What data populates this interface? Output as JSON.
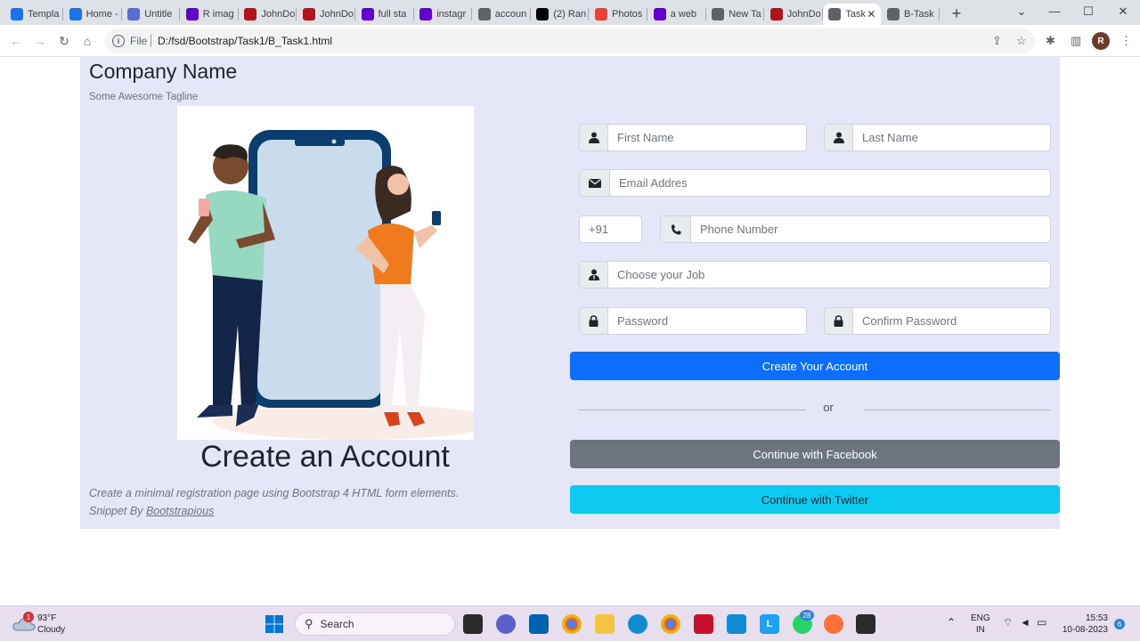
{
  "browser": {
    "tabs": [
      {
        "title": "Templa",
        "icon": "c-icon",
        "color": "#1a73e8"
      },
      {
        "title": "Home -",
        "icon": "c-icon",
        "color": "#1a73e8"
      },
      {
        "title": "Untitle",
        "icon": "doc-icon",
        "color": "#5b6bd6"
      },
      {
        "title": "R imag",
        "icon": "yahoo-icon",
        "color": "#6001d2"
      },
      {
        "title": "JohnDo",
        "icon": "r-icon",
        "color": "#b3131b"
      },
      {
        "title": "JohnDo",
        "icon": "r-icon",
        "color": "#b3131b"
      },
      {
        "title": "full sta",
        "icon": "yahoo-icon",
        "color": "#6001d2"
      },
      {
        "title": "instagr",
        "icon": "yahoo-icon",
        "color": "#6001d2"
      },
      {
        "title": "accoun",
        "icon": "globe-icon",
        "color": "#5f6368"
      },
      {
        "title": "(2) Ran",
        "icon": "x-icon",
        "color": "#000000"
      },
      {
        "title": "Photos",
        "icon": "photos-icon",
        "color": "#ea4335"
      },
      {
        "title": "a web",
        "icon": "yahoo-icon",
        "color": "#6001d2"
      },
      {
        "title": "New Ta",
        "icon": "globe-icon",
        "color": "#5f6368"
      },
      {
        "title": "JohnDo",
        "icon": "r-icon",
        "color": "#b3131b"
      },
      {
        "title": "Task",
        "icon": "globe-icon",
        "color": "#5f6368"
      },
      {
        "title": "B-Task",
        "icon": "globe-icon",
        "color": "#5f6368"
      }
    ],
    "active_tab_index": 14,
    "protocol": "File",
    "url": "D:/fsd/Bootstrap/Task1/B_Task1.html",
    "profile_initial": "R"
  },
  "page": {
    "company_name": "Company Name",
    "tagline": "Some Awesome Tagline",
    "heading": "Create an Account",
    "description": "Create a minimal registration page using Bootstrap 4 HTML form elements.",
    "snippet_prefix": "Snippet By ",
    "snippet_link": "Bootstrapious",
    "form": {
      "first_name_placeholder": "First Name",
      "last_name_placeholder": "Last Name",
      "email_placeholder": "Email Addres",
      "country_code": "+91",
      "phone_placeholder": "Phone Number",
      "job_placeholder": "Choose your Job",
      "password_placeholder": "Password",
      "confirm_password_placeholder": "Confirm Password",
      "create_button": "Create Your Account",
      "or_text": "or",
      "facebook_button": "Continue with Facebook",
      "twitter_button": "Continue with Twitter"
    },
    "colors": {
      "background": "#e6e6f9",
      "primary": "#0d6efd",
      "secondary": "#6c757d",
      "info": "#0dcaf0"
    }
  },
  "taskbar": {
    "weather_temp": "93°F",
    "weather_desc": "Cloudy",
    "weather_badge": "1",
    "search_label": "Search",
    "whatsapp_badge": "28",
    "lang_top": "ENG",
    "lang_bottom": "IN",
    "time": "15:53",
    "date": "10-08-2023",
    "notification_count": "6"
  }
}
